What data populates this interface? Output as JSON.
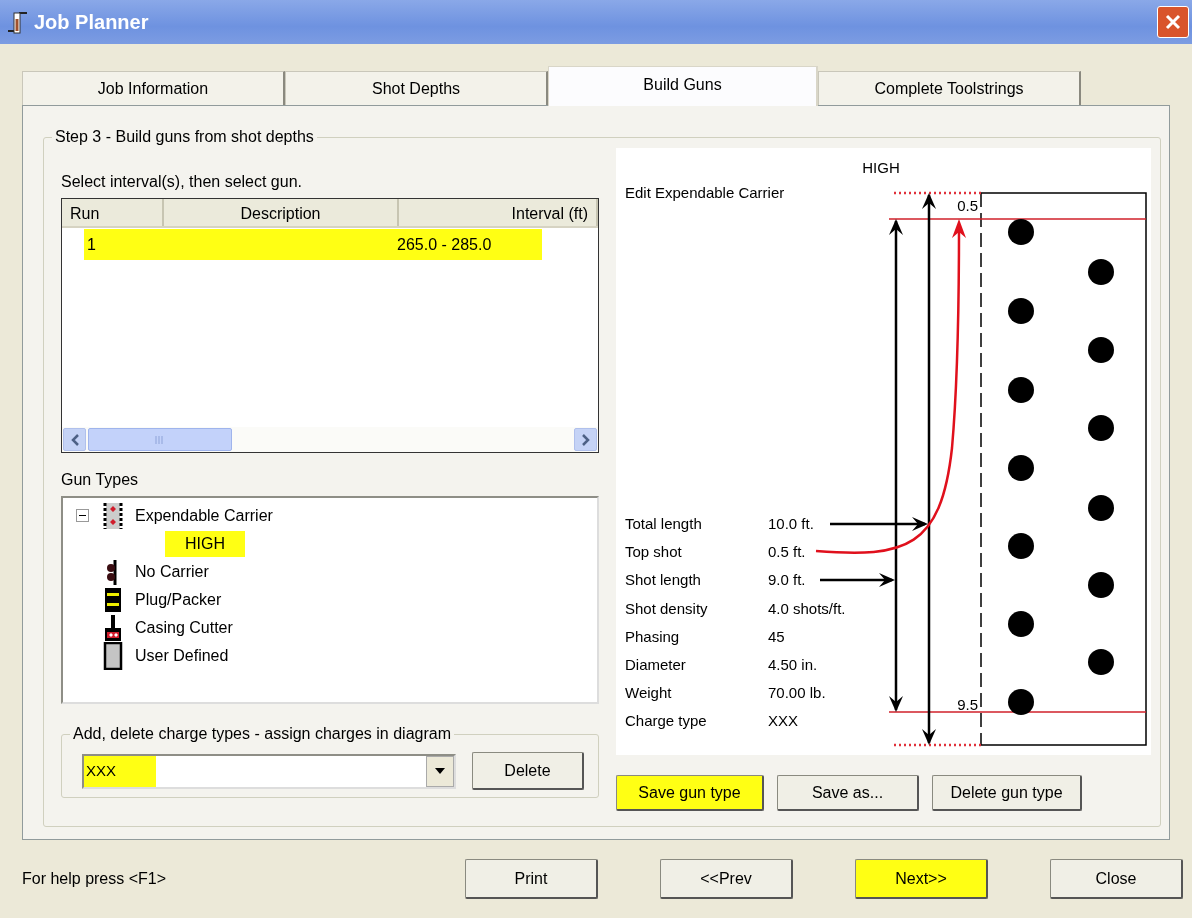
{
  "window": {
    "title": "Job Planner"
  },
  "tabs": [
    {
      "label": "Job Information",
      "selected": false
    },
    {
      "label": "Shot Depths",
      "selected": false
    },
    {
      "label": "Build Guns",
      "selected": true
    },
    {
      "label": "Complete Toolstrings",
      "selected": false
    }
  ],
  "step_group": {
    "legend": "Step 3 - Build guns from shot depths",
    "instruction": "Select interval(s), then select gun.",
    "interval_table": {
      "columns": [
        "Run",
        "Description",
        "Interval (ft)"
      ],
      "rows": [
        {
          "run": "1",
          "interval": "265.0 - 285.0",
          "highlighted": true
        }
      ]
    },
    "gun_types": {
      "label": "Gun Types",
      "tree": [
        {
          "label": "Expendable Carrier",
          "kind": "expendable",
          "expanded": true,
          "highlighted": false,
          "children": [
            {
              "label": "HIGH",
              "highlighted": true
            }
          ]
        },
        {
          "label": "No Carrier",
          "kind": "no-carrier",
          "highlighted": false
        },
        {
          "label": "Plug/Packer",
          "kind": "plug",
          "highlighted": false
        },
        {
          "label": "Casing Cutter",
          "kind": "cutter",
          "highlighted": false
        },
        {
          "label": "User Defined",
          "kind": "user",
          "highlighted": false
        }
      ]
    },
    "charge_types": {
      "legend": "Add, delete charge types - assign charges in diagram",
      "combo": {
        "value": "XXX",
        "highlighted": true
      },
      "delete_button": "Delete"
    },
    "diagram": {
      "title": "HIGH",
      "edit_label": "Edit Expendable Carrier",
      "top_marker": "0.5",
      "bottom_marker": "9.5",
      "properties": [
        {
          "label": "Total length",
          "value": "10.0 ft."
        },
        {
          "label": "Top shot",
          "value": "0.5 ft."
        },
        {
          "label": "Shot length",
          "value": "9.0 ft."
        },
        {
          "label": "Shot density",
          "value": "4.0 shots/ft."
        },
        {
          "label": "Phasing",
          "value": "45"
        },
        {
          "label": "Diameter",
          "value": "4.50 in."
        },
        {
          "label": "Weight",
          "value": "70.00 lb."
        },
        {
          "label": "Charge type",
          "value": "XXX"
        }
      ]
    },
    "diagram_buttons": [
      {
        "label": "Save gun type",
        "highlighted": true
      },
      {
        "label": "Save as...",
        "highlighted": false
      },
      {
        "label": "Delete gun type",
        "highlighted": false
      }
    ]
  },
  "status_text": "For help press <F1>",
  "footer_buttons": [
    {
      "label": "Print",
      "highlighted": false
    },
    {
      "label": "<<Prev",
      "highlighted": false
    },
    {
      "label": "Next>>",
      "highlighted": true
    },
    {
      "label": "Close",
      "highlighted": false
    }
  ]
}
